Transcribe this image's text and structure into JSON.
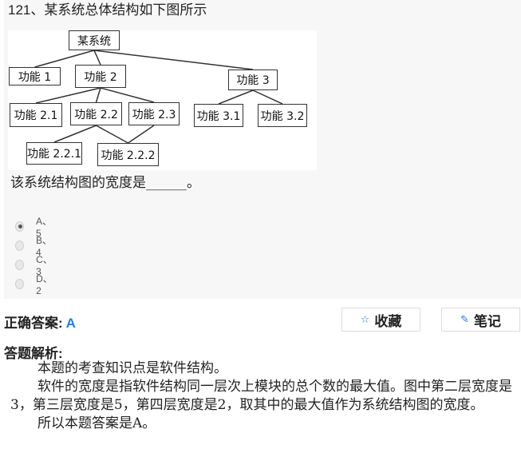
{
  "question": {
    "title": "121、某系统总体结构如下图所示",
    "stem": "该系统结构图的宽度是______。",
    "figure": {
      "nodes": [
        {
          "id": "root",
          "label": "某系统"
        },
        {
          "id": "f1",
          "label": "功能 1"
        },
        {
          "id": "f2",
          "label": "功能 2"
        },
        {
          "id": "f3",
          "label": "功能 3"
        },
        {
          "id": "f21",
          "label": "功能 2.1"
        },
        {
          "id": "f22",
          "label": "功能 2.2"
        },
        {
          "id": "f23",
          "label": "功能 2.3"
        },
        {
          "id": "f31",
          "label": "功能 3.1"
        },
        {
          "id": "f32",
          "label": "功能 3.2"
        },
        {
          "id": "f221",
          "label": "功能 2.2.1"
        },
        {
          "id": "f222",
          "label": "功能 2.2.2"
        }
      ],
      "edges": [
        [
          "root",
          "f1"
        ],
        [
          "root",
          "f2"
        ],
        [
          "root",
          "f3"
        ],
        [
          "f2",
          "f21"
        ],
        [
          "f2",
          "f22"
        ],
        [
          "f2",
          "f23"
        ],
        [
          "f3",
          "f31"
        ],
        [
          "f3",
          "f32"
        ],
        [
          "f22",
          "f221"
        ],
        [
          "f22",
          "f222"
        ],
        [
          "f23",
          "f222"
        ]
      ]
    },
    "options": [
      {
        "label": "A、5",
        "checked": true
      },
      {
        "label": "B、4",
        "checked": false
      },
      {
        "label": "C、3",
        "checked": false
      },
      {
        "label": "D、2",
        "checked": false
      }
    ]
  },
  "answer": {
    "label": "正确答案:",
    "value": "A",
    "color": "#1e7ee8"
  },
  "buttons": {
    "favorite": {
      "icon": "star-icon",
      "label": "收藏"
    },
    "note": {
      "icon": "pencil-icon",
      "label": "笔记"
    }
  },
  "analysis": {
    "title": "答题解析:",
    "paragraphs": [
      "本题的考查知识点是软件结构。",
      "软件的宽度是指软件结构同一层次上模块的总个数的最大值。图中第二层宽度是3，第三层宽度是5，第四层宽度是2，取其中的最大值作为系统结构图的宽度。",
      "所以本题答案是A。"
    ]
  }
}
